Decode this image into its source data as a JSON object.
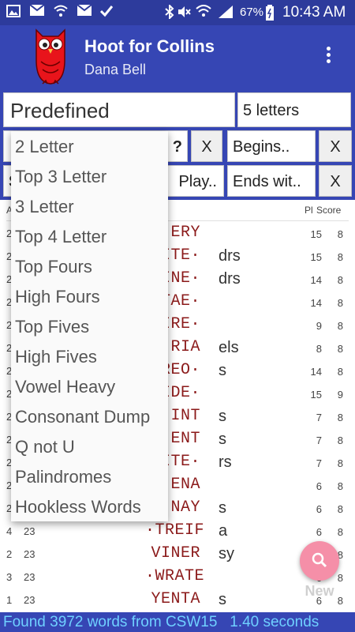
{
  "status_bar": {
    "battery": "67%",
    "time": "10:43 AM"
  },
  "app_bar": {
    "title": "Hoot for Collins",
    "subtitle": "Dana Bell"
  },
  "controls": {
    "list_select": "Predefined",
    "length_field": "5 letters",
    "pattern_field": "?",
    "clear_label": "X",
    "begins_field": "Begins..",
    "play_field": "Play..",
    "ends_field": "Ends wit..",
    "row2_left_letter": "S"
  },
  "table": {
    "header": {
      "alpha_col": "A",
      "pl_col": "Pl",
      "score_col": "Score"
    },
    "rows": [
      {
        "a": "2",
        "b": "",
        "word": "ERY",
        "hooks": "",
        "pl": "15",
        "score": "8"
      },
      {
        "a": "2",
        "b": "",
        "word": "ITE·",
        "hooks": "drs",
        "pl": "15",
        "score": "8"
      },
      {
        "a": "2",
        "b": "",
        "word": "INE·",
        "hooks": "drs",
        "pl": "14",
        "score": "8"
      },
      {
        "a": "2",
        "b": "",
        "word": "TAE·",
        "hooks": "",
        "pl": "14",
        "score": "8"
      },
      {
        "a": "2",
        "b": "",
        "word": "IRE·",
        "hooks": "",
        "pl": "9",
        "score": "8"
      },
      {
        "a": "2",
        "b": "",
        "word": "RIA",
        "hooks": "els",
        "pl": "8",
        "score": "8"
      },
      {
        "a": "2",
        "b": "",
        "word": "REO·",
        "hooks": "s",
        "pl": "14",
        "score": "8"
      },
      {
        "a": "2",
        "b": "",
        "word": "IDE·",
        "hooks": "",
        "pl": "15",
        "score": "9"
      },
      {
        "a": "2",
        "b": "",
        "word": "INT",
        "hooks": "s",
        "pl": "7",
        "score": "8"
      },
      {
        "a": "2",
        "b": "",
        "word": "ENT",
        "hooks": "s",
        "pl": "7",
        "score": "8"
      },
      {
        "a": "2",
        "b": "",
        "word": "ITE·",
        "hooks": "rs",
        "pl": "7",
        "score": "8"
      },
      {
        "a": "2",
        "b": "",
        "word": "ENA",
        "hooks": "",
        "pl": "6",
        "score": "8"
      },
      {
        "a": "2",
        "b": "",
        "word": "NAY",
        "hooks": "s",
        "pl": "6",
        "score": "8"
      },
      {
        "a": "4",
        "b": "23",
        "word": "·TREIF",
        "hooks": "a",
        "pl": "6",
        "score": "8"
      },
      {
        "a": "2",
        "b": "23",
        "word": "VINER",
        "hooks": "sy",
        "pl": "6",
        "score": "8"
      },
      {
        "a": "3",
        "b": "23",
        "word": "·WRATE",
        "hooks": "",
        "pl": "6",
        "score": "8"
      },
      {
        "a": "1",
        "b": "23",
        "word": "YENTA",
        "hooks": "s",
        "pl": "6",
        "score": "8"
      }
    ]
  },
  "dropdown": {
    "items": [
      "2 Letter",
      "Top 3 Letter",
      "3 Letter",
      "Top 4 Letter",
      "Top Fours",
      "High Fours",
      "Top Fives",
      "High Fives",
      "Vowel Heavy",
      "Consonant Dump",
      "Q not U",
      "Palindromes",
      "Hookless Words"
    ]
  },
  "fab": {
    "label": "New",
    "color": "#f58fa8"
  },
  "footer": {
    "text": "Found 3972 words from CSW15   1.40 seconds"
  },
  "colors": {
    "primary": "#3646b4",
    "status": "#2d3b9c",
    "word": "#8b1a1a",
    "footer_text": "#6fd0ff"
  },
  "icons": [
    "image-icon",
    "mail-icon",
    "wifi-icon",
    "mail-icon",
    "check-icon",
    "bluetooth-icon",
    "mute-icon",
    "wifi-icon",
    "signal-icon",
    "battery-icon",
    "owl-logo-icon",
    "overflow-menu-icon",
    "search-icon"
  ]
}
